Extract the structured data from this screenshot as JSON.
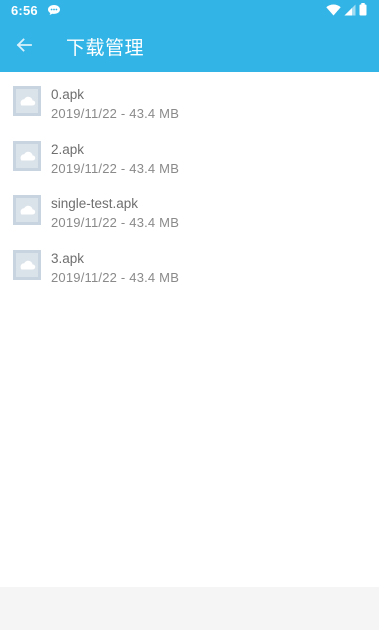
{
  "status_bar": {
    "time": "6:56",
    "icons": [
      "chat-bubble-icon",
      "wifi-icon",
      "cell-signal-icon",
      "battery-icon"
    ]
  },
  "app_bar": {
    "back_icon": "arrow-left-icon",
    "title": "下载管理"
  },
  "downloads": [
    {
      "name": "0.apk",
      "date": "2019/11/22",
      "separator": "-",
      "size": "43.4 MB"
    },
    {
      "name": "2.apk",
      "date": "2019/11/22",
      "separator": "-",
      "size": "43.4 MB"
    },
    {
      "name": "single-test.apk",
      "date": "2019/11/22",
      "separator": "-",
      "size": "43.4 MB"
    },
    {
      "name": "3.apk",
      "date": "2019/11/22",
      "separator": "-",
      "size": "43.4 MB"
    }
  ],
  "colors": {
    "primary": "#32b4e6",
    "file_icon": "#c8d4df",
    "name_text": "#6f6f6f",
    "meta_text": "#8a8a8a",
    "bottom_bar": "#f5f5f5"
  }
}
